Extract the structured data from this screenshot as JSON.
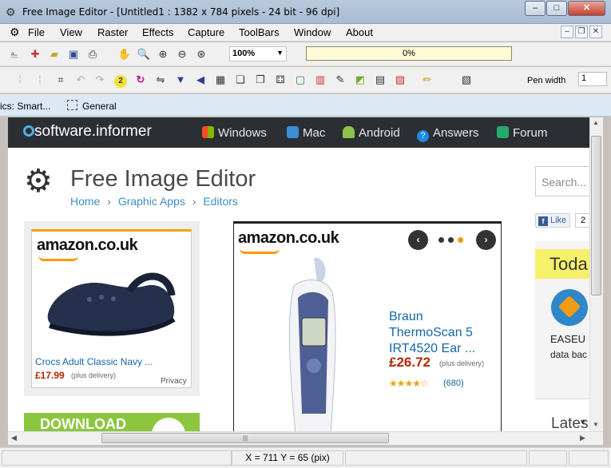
{
  "window": {
    "title": "Free Image Editor - [Untitled1 : 1382 x 784 pixels - 24 bit - 96 dpi]",
    "minimize": "–",
    "maximize": "□",
    "close": "✕"
  },
  "menu": [
    "File",
    "View",
    "Raster",
    "Effects",
    "Capture",
    "ToolBars",
    "Window",
    "About"
  ],
  "toolbar": {
    "zoom": "100%",
    "progress": "0%",
    "pen_width_label": "Pen width",
    "pen_width_value": "1"
  },
  "tabs": {
    "tab1": "ics: Smart...",
    "tab2": "General"
  },
  "webpage": {
    "logo": "software.informer",
    "nav": [
      "Windows",
      "Mac",
      "Android",
      "Answers",
      "Forum"
    ],
    "page_title": "Free Image Editor",
    "breadcrumb": [
      "Home",
      "Graphic Apps",
      "Editors"
    ],
    "search_placeholder": "Search...",
    "like_label": "Like",
    "like_count": "2",
    "ad1": {
      "brand": "amazon.co.uk",
      "product": "Crocs Adult Classic Navy ...",
      "price": "£17.99",
      "shipping": "(plus delivery)",
      "privacy": "Privacy"
    },
    "ad2": {
      "brand": "amazon.co.uk",
      "product": "Braun ThermoScan 5 IRT4520 Ear ...",
      "price": "£26.72",
      "shipping": "(plus delivery)",
      "reviews": "(680)",
      "rating": 4.5
    },
    "download_label": "DOWNLOAD",
    "today_label": "Toda",
    "easeus_label": "EASEU",
    "data_label": "data bac",
    "latest_label": "Lates"
  },
  "status": {
    "coords": "X = 711   Y = 65 (pix)"
  },
  "colors": {
    "nav_bg": "#2b2e33",
    "link": "#3f8fc8",
    "price": "#b12704",
    "progress_bg": "#fffbd7",
    "download_green": "#8cc63f"
  }
}
